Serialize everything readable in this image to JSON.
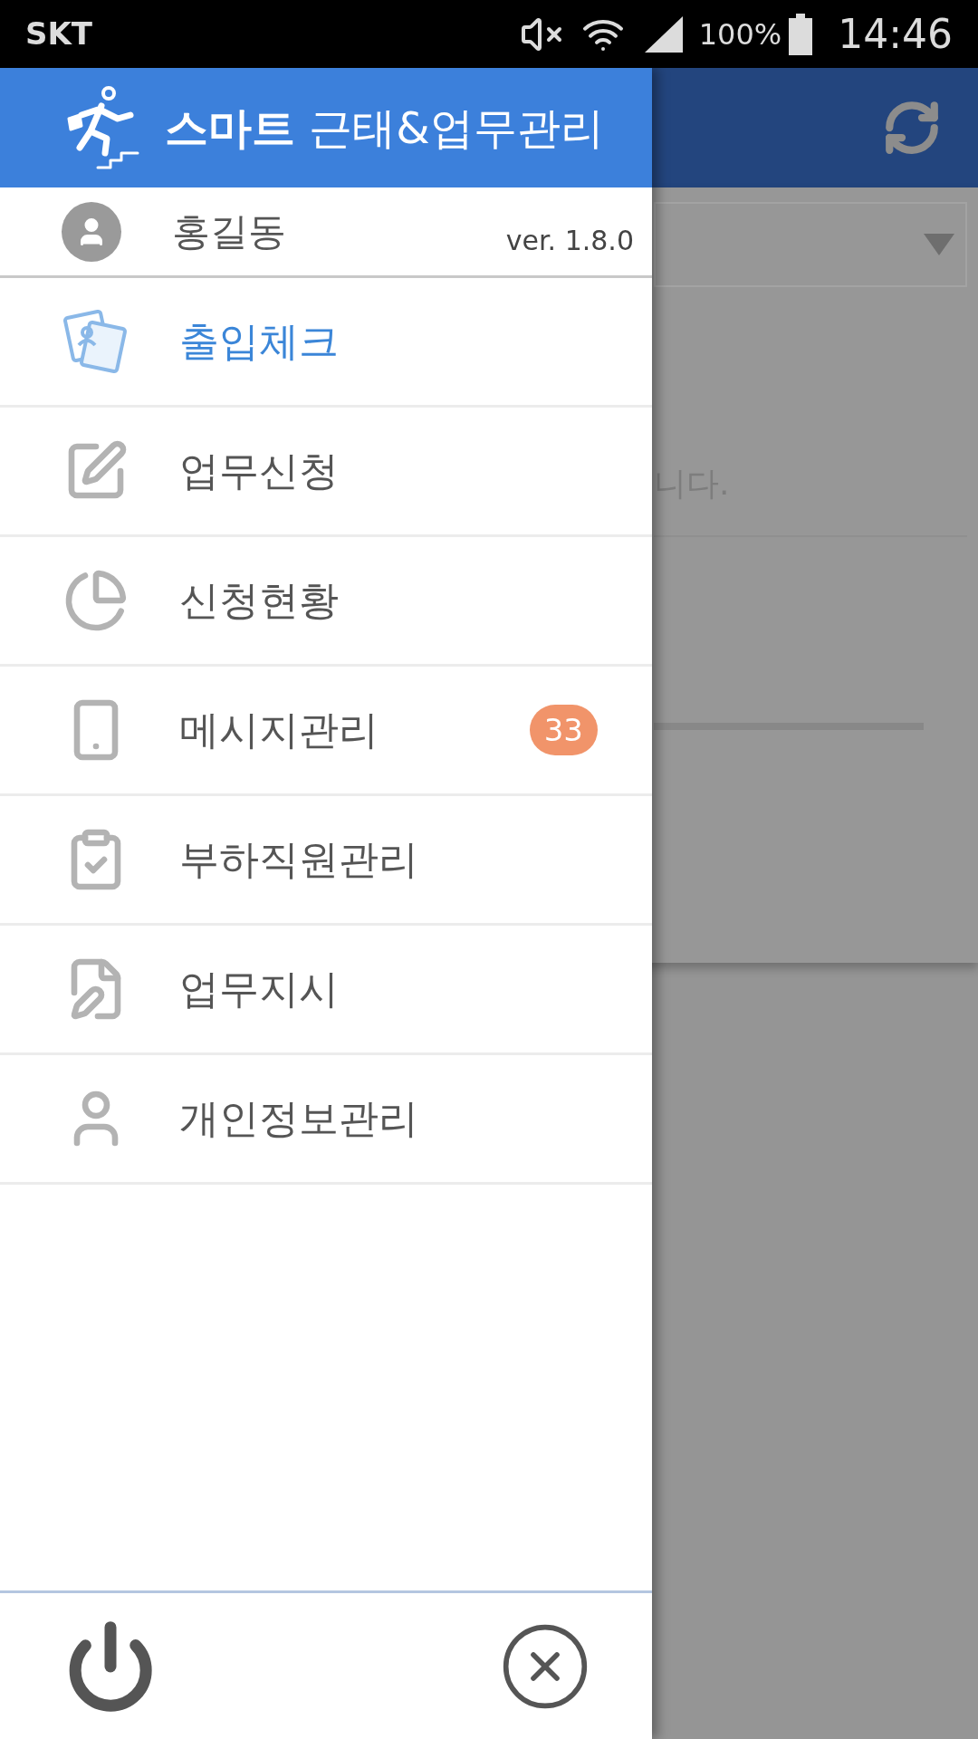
{
  "status_bar": {
    "carrier": "SKT",
    "battery": "100%",
    "time": "14:46"
  },
  "background_fragments": [
    "니다."
  ],
  "drawer": {
    "title_bold": "스마트",
    "title": "근태&업무관리",
    "user_name": "홍길동",
    "version": "ver. 1.8.0",
    "items": [
      {
        "label": "출입체크",
        "kind": "id",
        "selected": true
      },
      {
        "label": "업무신청",
        "kind": "edit",
        "selected": false
      },
      {
        "label": "신청현황",
        "kind": "pie",
        "selected": false
      },
      {
        "label": "메시지관리",
        "kind": "phone",
        "selected": false,
        "badge": "33"
      },
      {
        "label": "부하직원관리",
        "kind": "check",
        "selected": false
      },
      {
        "label": "업무지시",
        "kind": "list",
        "selected": false
      },
      {
        "label": "개인정보관리",
        "kind": "person",
        "selected": false
      }
    ]
  }
}
